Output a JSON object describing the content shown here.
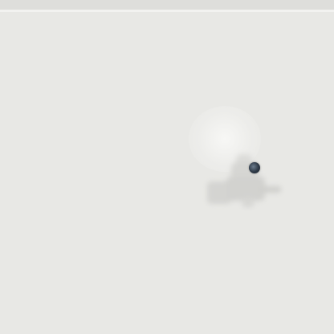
{
  "screen": {
    "background_color": "#e8e8e5",
    "top_strip_color": "#dededb"
  },
  "icons": {
    "pointer": "cursor-dot-icon",
    "object": "blurred-figure-icon"
  },
  "colors": {
    "pointer": "#2d3845",
    "object_tint": "#d4d4d1"
  }
}
